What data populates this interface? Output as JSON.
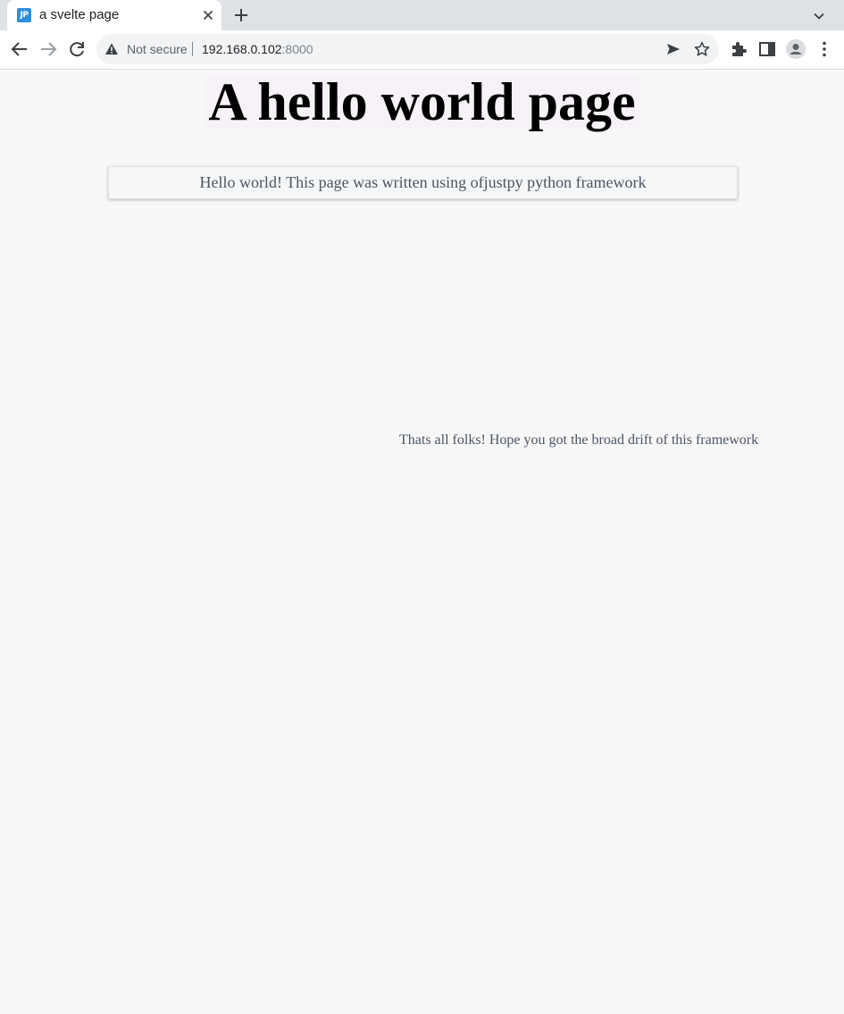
{
  "browser": {
    "tab": {
      "favicon_text": "JP",
      "favicon_color": "#2f8fdc",
      "title": "a svelte page"
    },
    "address_bar": {
      "security_label": "Not secure",
      "url_host": "192.168.0.102",
      "url_port": ":8000"
    },
    "icons": {
      "back": "back-arrow-icon",
      "forward": "forward-arrow-icon",
      "reload": "reload-icon",
      "warning": "warning-icon",
      "send": "send-icon",
      "bookmark": "star-icon",
      "extensions": "puzzle-icon",
      "side_panel": "side-panel-icon",
      "profile": "profile-icon",
      "menu": "kebab-menu-icon",
      "new_tab": "plus-icon",
      "tab_search": "chevron-down-icon",
      "close_tab": "close-icon"
    }
  },
  "page": {
    "heading": "A hello world page",
    "card_text": "Hello world! This page was written using ofjustpy python framework",
    "footer_text": "Thats all folks! Hope you got the broad drift of this framework"
  }
}
